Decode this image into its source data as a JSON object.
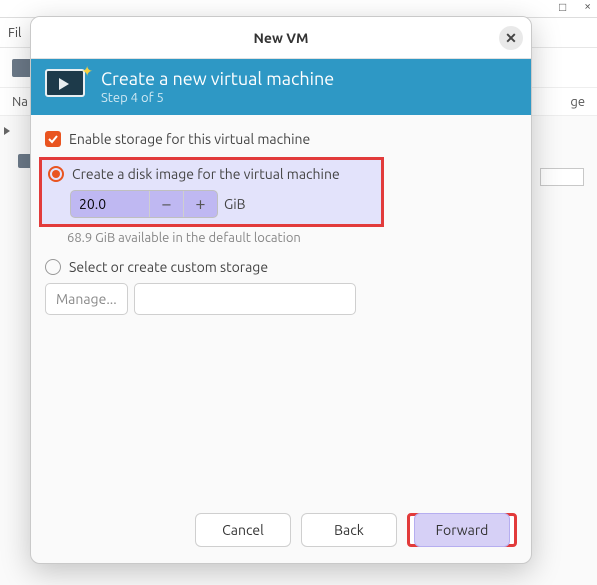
{
  "bg": {
    "menu_file": "Fil",
    "col_name": "Na",
    "col_usage": "ge"
  },
  "dialog": {
    "title": "New VM",
    "header_title": "Create a new virtual machine",
    "header_step": "Step 4 of 5",
    "enable_storage_label": "Enable storage for this virtual machine",
    "create_disk_label": "Create a disk image for the virtual machine",
    "disk_size_value": "20.0",
    "disk_unit": "GiB",
    "available_text": "68.9 GiB available in the default location",
    "custom_storage_label": "Select or create custom storage",
    "manage_button": "Manage...",
    "buttons": {
      "cancel": "Cancel",
      "back": "Back",
      "forward": "Forward"
    }
  }
}
